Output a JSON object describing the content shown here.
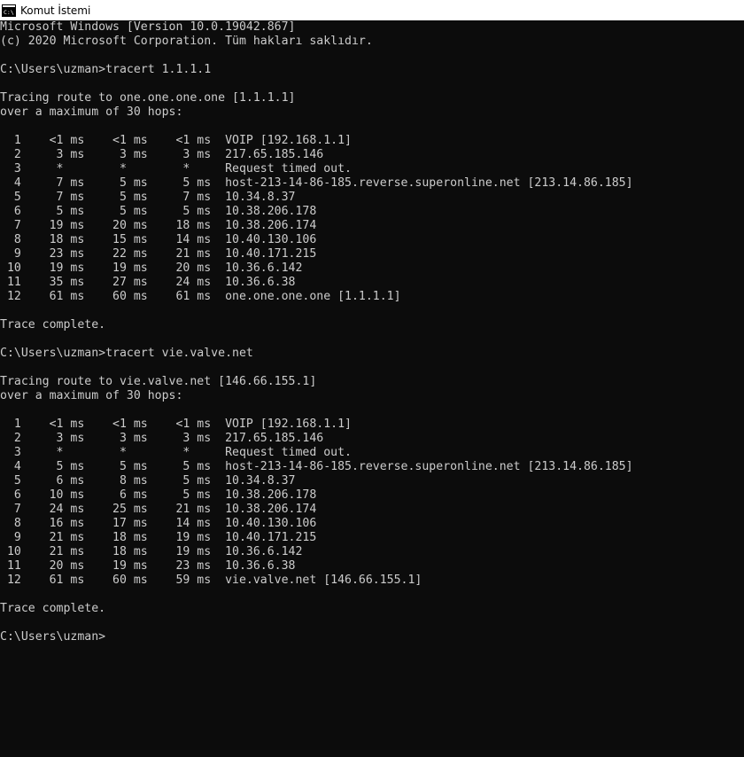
{
  "window": {
    "icon": "cmd-icon",
    "title": "Komut İstemi"
  },
  "console": {
    "lines": [
      "Microsoft Windows [Version 10.0.19042.867]",
      "(c) 2020 Microsoft Corporation. Tüm hakları saklıdır.",
      "",
      "C:\\Users\\uzman>tracert 1.1.1.1",
      "",
      "Tracing route to one.one.one.one [1.1.1.1]",
      "over a maximum of 30 hops:",
      "",
      "  1    <1 ms    <1 ms    <1 ms  VOIP [192.168.1.1]",
      "  2     3 ms     3 ms     3 ms  217.65.185.146",
      "  3     *        *        *     Request timed out.",
      "  4     7 ms     5 ms     5 ms  host-213-14-86-185.reverse.superonline.net [213.14.86.185]",
      "  5     7 ms     5 ms     7 ms  10.34.8.37",
      "  6     5 ms     5 ms     5 ms  10.38.206.178",
      "  7    19 ms    20 ms    18 ms  10.38.206.174",
      "  8    18 ms    15 ms    14 ms  10.40.130.106",
      "  9    23 ms    22 ms    21 ms  10.40.171.215",
      " 10    19 ms    19 ms    20 ms  10.36.6.142",
      " 11    35 ms    27 ms    24 ms  10.36.6.38",
      " 12    61 ms    60 ms    61 ms  one.one.one.one [1.1.1.1]",
      "",
      "Trace complete.",
      "",
      "C:\\Users\\uzman>tracert vie.valve.net",
      "",
      "Tracing route to vie.valve.net [146.66.155.1]",
      "over a maximum of 30 hops:",
      "",
      "  1    <1 ms    <1 ms    <1 ms  VOIP [192.168.1.1]",
      "  2     3 ms     3 ms     3 ms  217.65.185.146",
      "  3     *        *        *     Request timed out.",
      "  4     5 ms     5 ms     5 ms  host-213-14-86-185.reverse.superonline.net [213.14.86.185]",
      "  5     6 ms     8 ms     5 ms  10.34.8.37",
      "  6    10 ms     6 ms     5 ms  10.38.206.178",
      "  7    24 ms    25 ms    21 ms  10.38.206.174",
      "  8    16 ms    17 ms    14 ms  10.40.130.106",
      "  9    21 ms    18 ms    19 ms  10.40.171.215",
      " 10    21 ms    18 ms    19 ms  10.36.6.142",
      " 11    20 ms    19 ms    23 ms  10.36.6.38",
      " 12    61 ms    60 ms    59 ms  vie.valve.net [146.66.155.1]",
      "",
      "Trace complete.",
      "",
      "C:\\Users\\uzman>"
    ]
  },
  "colors": {
    "console_background": "#0c0c0c",
    "console_text": "#cccccc",
    "titlebar_background": "#ffffff"
  }
}
